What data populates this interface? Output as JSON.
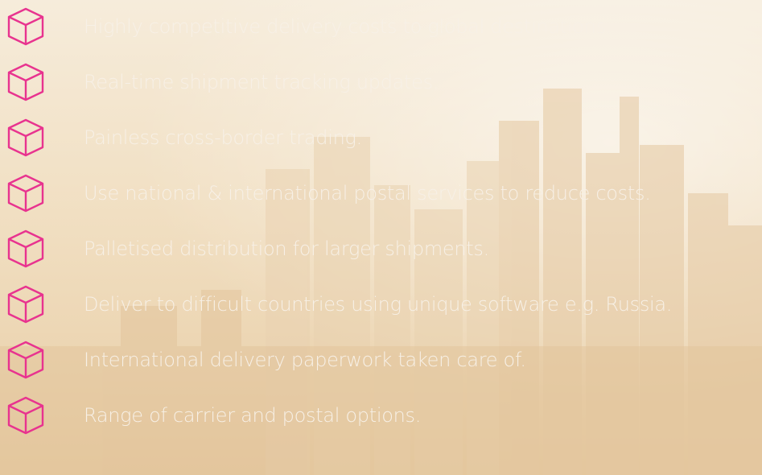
{
  "accent_color": "#e8338f",
  "text_color": "#f7f0e6",
  "features": [
    {
      "icon": "box-icon",
      "text": "Highly competitive delivery costs to global destinations."
    },
    {
      "icon": "box-icon",
      "text": "Real-time shipment tracking updates."
    },
    {
      "icon": "box-icon",
      "text": "Painless cross-border trading."
    },
    {
      "icon": "box-icon",
      "text": "Use national & international postal services to reduce costs."
    },
    {
      "icon": "box-icon",
      "text": "Palletised distribution for larger shipments."
    },
    {
      "icon": "box-icon",
      "text": "Deliver to difficult countries using unique software e.g. Russia."
    },
    {
      "icon": "box-icon",
      "text": "International delivery paperwork taken care of."
    },
    {
      "icon": "box-icon",
      "text": "Range of carrier and postal options."
    }
  ]
}
